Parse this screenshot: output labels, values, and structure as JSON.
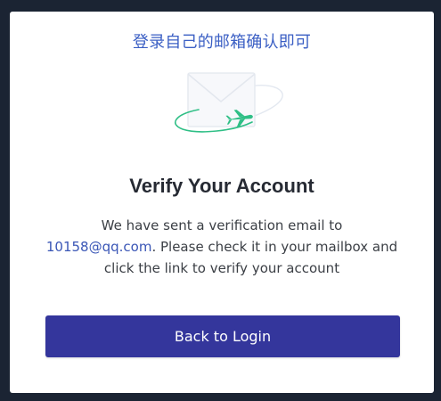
{
  "annotation": "登录自己的邮箱确认即可",
  "title": "Verify Your Account",
  "message": {
    "line1": "We have sent a verification email to",
    "email": "10158@qq.com",
    "line2": ". Please check it in your mailbox and",
    "line3": "click the link to verify your account"
  },
  "button": {
    "label": "Back to Login"
  },
  "icons": {
    "illustration": "envelope-airplane-icon"
  },
  "colors": {
    "background": "#1b2433",
    "card": "#ffffff",
    "annotation": "#3b5fc4",
    "email_link": "#3a56b6",
    "button": "#34369c",
    "accent_green": "#2fbf86"
  }
}
